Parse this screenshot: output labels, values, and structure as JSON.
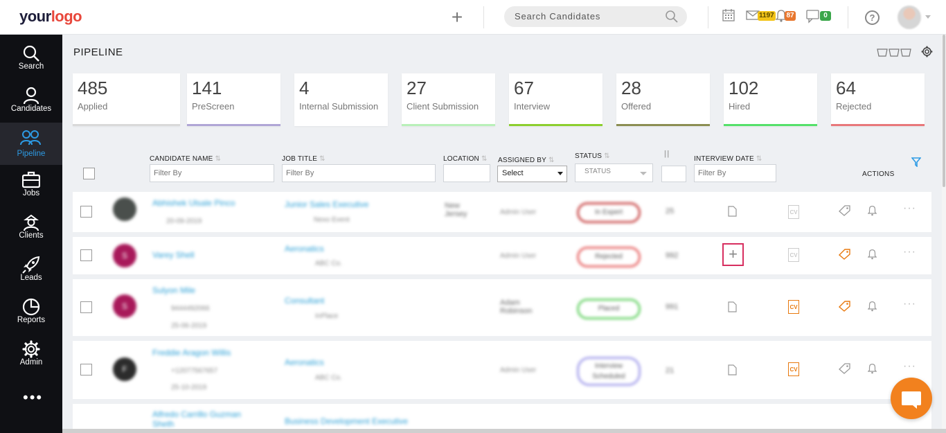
{
  "header": {
    "logo_part1": "your",
    "logo_part2": "logo",
    "search_placeholder": "Search Candidates",
    "mail_count": "1197",
    "notification_count": "87",
    "chat_count": "0",
    "help_label": "?"
  },
  "sidebar": {
    "items": [
      {
        "label": "Search",
        "icon": "search-icon"
      },
      {
        "label": "Candidates",
        "icon": "user-icon"
      },
      {
        "label": "Pipeline",
        "icon": "users-icon"
      },
      {
        "label": "Jobs",
        "icon": "briefcase-icon"
      },
      {
        "label": "Clients",
        "icon": "client-icon"
      },
      {
        "label": "Leads",
        "icon": "rocket-icon"
      },
      {
        "label": "Reports",
        "icon": "pie-chart-icon"
      },
      {
        "label": "Admin",
        "icon": "gear-icon"
      }
    ],
    "active": "Pipeline",
    "more_label": "•••"
  },
  "page": {
    "title": "PIPELINE"
  },
  "stats": [
    {
      "value": "485",
      "label": "Applied",
      "color": "#d9d9d9"
    },
    {
      "value": "141",
      "label": "PreScreen",
      "color": "#b0a6d6"
    },
    {
      "value": "4",
      "label": "Internal Submission",
      "color": "#ffffff"
    },
    {
      "value": "27",
      "label": "Client Submission",
      "color": "#b9f0b9"
    },
    {
      "value": "67",
      "label": "Interview",
      "color": "#8ccf2e"
    },
    {
      "value": "28",
      "label": "Offered",
      "color": "#8b8e52"
    },
    {
      "value": "102",
      "label": "Hired",
      "color": "#55e06a"
    },
    {
      "value": "64",
      "label": "Rejected",
      "color": "#e8777a"
    }
  ],
  "table": {
    "headers": {
      "candidate_name": "CANDIDATE NAME",
      "job_title": "JOB TITLE",
      "location": "LOCATION",
      "assigned_by": "ASSIGNED BY",
      "status": "STATUS",
      "interview_date": "INTERVIEW DATE",
      "actions": "ACTIONS"
    },
    "filters": {
      "candidate_name_placeholder": "Filter By",
      "job_title_placeholder": "Filter By",
      "assigned_by_value": "Select",
      "status_value": "STATUS",
      "interview_date_placeholder": "Filter By"
    },
    "sort_glyph": "⇅",
    "pause_glyph": "||",
    "rows": [
      {
        "avatar": "",
        "name": "Abhishek Ulsale Pinco",
        "sub1": "",
        "sub2": "20-09-2019",
        "job": "Junior Sales Executive",
        "job_sub": "Nexo Event",
        "location": "New Jersey",
        "assigned": "Admin User",
        "status": "In Expert",
        "status_color": "#c94b4b",
        "num": "25"
      },
      {
        "avatar": "S",
        "name": "Varey Shell",
        "sub1": "",
        "sub2": "",
        "job": "Aeronatics",
        "job_sub": "ABC Co.",
        "location": "",
        "assigned": "Admin User",
        "status": "Rejected",
        "status_color": "#e86a6a",
        "num": "992"
      },
      {
        "avatar": "S",
        "name": "Sulyon Mile",
        "sub1": "9444492066",
        "sub2": "25-06-2019",
        "job": "Consultant",
        "job_sub": "InPlace",
        "location": "",
        "assigned": "Adam Robinson",
        "status": "Placed",
        "status_color": "#6bd36b",
        "num": "991"
      },
      {
        "avatar": "F",
        "name": "Freddie Aragon Willis",
        "sub1": "+12077567657",
        "sub2": "25-10-2019",
        "job": "Aeronatics",
        "job_sub": "ABC Co.",
        "location": "",
        "assigned": "Admin User",
        "status": "Interview Scheduled",
        "status_color": "#a7a3ec",
        "num": "21"
      },
      {
        "avatar": "",
        "name": "Alfredo Carrillo Guzman Sheth",
        "sub1": "",
        "sub2": "",
        "job": "Business Development Executive",
        "job_sub": "",
        "location": "",
        "assigned": "",
        "status": "",
        "status_color": "#ffffff",
        "num": ""
      }
    ]
  },
  "colors": {
    "accent": "#2d9be5",
    "sidebar_bg": "#0f1014",
    "chat_bubble": "#f2811e",
    "highlight_border": "#d72e5f",
    "cv_orange": "#e8790e"
  }
}
